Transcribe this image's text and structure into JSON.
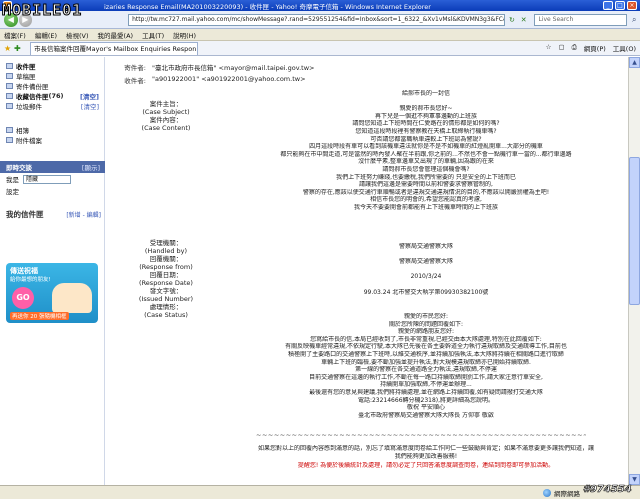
{
  "window": {
    "title": "izaries Response Email(MA201003220093) - 收件匣 - Yahoo! 奇摩電子信箱 - Windows Internet Explorer",
    "address": "http://tw.mc727.mail.yahoo.com/mc/showMessage?.rand=529551254&fid=Inbox&sort=1_6322_&Xv1vMsl&KDVMN3g3&FC&RhBM8",
    "search_placeholder": "Live Search"
  },
  "menu": [
    "檔案(F)",
    "編輯(E)",
    "檢視(V)",
    "我的最愛(A)",
    "工具(T)",
    "說明(H)"
  ],
  "tab": {
    "label": "市長信箱案件回覆Mayor's Mailbox Enquiries Respon..."
  },
  "tools": [
    "☆",
    "▢",
    "⎙",
    "網頁(P)",
    "工具(O)"
  ],
  "sidebar": {
    "folders": [
      {
        "label": "收件匣",
        "bold": true
      },
      {
        "label": "草稿匣"
      },
      {
        "label": "寄件備份匣"
      },
      {
        "label": "收藏信件匣",
        "count": "(76)",
        "action": "[清空]"
      },
      {
        "label": "垃圾郵件",
        "action": "[清空]"
      }
    ],
    "extra": [
      {
        "label": "相簿"
      },
      {
        "label": "附件檔案"
      }
    ],
    "im_section": {
      "title": "即時交談",
      "action": "[顯示]",
      "status_label": "我是",
      "status_value": "隱藏",
      "settings": "設定"
    },
    "friends": {
      "title": "我的信件匣",
      "action": "[新增 - 編輯]"
    },
    "promo": {
      "line1": "傳送祝福",
      "line2": "給你最想的朋友!",
      "badge": "GO",
      "line3": "再送你 20 張隨機相框"
    }
  },
  "message": {
    "from_label": "寄件者:",
    "from_value": "\"臺北市政府市長信箱\" <mayor@mail.taipei.gov.tw>",
    "to_label": "收件者:",
    "to_value": "\"a901922001\" <a901922001@yahoo.com.tw>",
    "meta_labels_1": [
      "案件主旨：",
      "(Case Subject)",
      "案件內容：",
      "(Case Content)"
    ],
    "meta_labels_2": [
      "受理機關：",
      "(Handled by)",
      "回覆機關：",
      "(Response from)",
      "回覆日期：",
      "(Response Date)",
      "發文字號：",
      "(Issued Number)",
      "處理情形：",
      "(Case Status)"
    ],
    "body_lines_1": [
      "給郝市長的一封信",
      "",
      "親愛的郝市長您好~",
      "再下兒是一個逛不夠軍事邊動的上班族",
      "請問您知道上下班時間在仁愛路在的情形都是如何的嗎?",
      "您知道這段時段裡有警察教在天橋上取締執行機車嗎?",
      "可否請您都當職執車違較上下班認為警說?",
      "四月這段時段有車可以看到該機車違法就你是不是不如機車的紅燈亂開車...大部分的機車",
      "都只能夠在市中間走道,可是當然的時內發人聚在半前跟,你之前的...不然也不會一點機行車一當的...都行車邊路",
      "沒什麼平素,整車邊車又出現了的車輛,因為跟的在來",
      "請問郝市長您會管理這個機會嗎?",
      "我們上下班努力賺錢,也要繳稅,我們所需要的 只是安全的上下班而已",
      "請讓我們這邊是需要時間以前和警要求警察管制的,",
      "警察的存在,應該以使交通行車順暢或者是違規交通違規情況的目的,不應該以開嚴罰權為主吧!",
      "相信市長您的明會的,希望您能認真的考慮,",
      "我今天不要要開會前都能有上下班機車時間的上下班族"
    ],
    "body_lines_2": [
      "警察局交通警察大隊",
      "",
      "警察局交通警察大隊",
      "",
      "2010/3/24",
      "",
      "99.03.24 北市警交大執字第09930382100號"
    ],
    "body_lines_3": [
      "親愛的市民您好:",
      "關於您所陳的問題回覆如下:",
      "親愛的網路朋友您好:",
      "您寫給市長的信,本局已經收到了,市長非常重視,已經交由本大隊處理,特別在此回覆如下:",
      "有關反映機車經常違規,不依規定行駛,本大隊已先後在各主要幹道全力執行違規取締及交通疏導工作,目前也",
      "積極開了主要路口的交通警察上下班時,以維交通秩序,並持續加強執法,本大隊將持續在相關路口進行取締",
      "車輛上下班的臨檢,要不斷加強並提升執法,對大規模違規取締亦已開始持續取締.",
      "第一線的警察在各交通道路全力執法,違規取締,不停運",
      "目前交通警察在這邊的執行工作,不斷在每一路口持續取締開罰工作,請大家注意行車安全,",
      "持續開單加強取締,不停運並辦理...",
      "最後還有您的意見與建議,我們將持續處理,並在網路上持續回覆,如有疑問請撥打交通大隊",
      "電話:23214666轉分機2318),將更詳細為您說明。",
      "敬祝 平安順心",
      "臺北市政府警察局交通警察大隊大隊長 方仰寧 敬啟"
    ],
    "divider": "~~~~~~~~~~~~~~~~~~~~~~~~~~~~~~~~~~~~~~~~~~~~~~~~~~~~~~~~~~~",
    "footer_1": "如果您對以上的回覆內容感到滿意的話，別忘了填寫滿意度問卷給工作同仁一些鼓勵與肯定；如果不滿意要更多讓我們知道，讓",
    "footer_2": "我們能夠更加改善服務!",
    "footer_red": "提醒您! 為便於後續統計及處理，請勿必定了只回答滿意度調查問卷，連結到問卷即可參加活動。"
  },
  "statusbar": {
    "zone": "網際網路"
  },
  "watermark": {
    "logo": "MOBILE01",
    "id": "#974554"
  }
}
